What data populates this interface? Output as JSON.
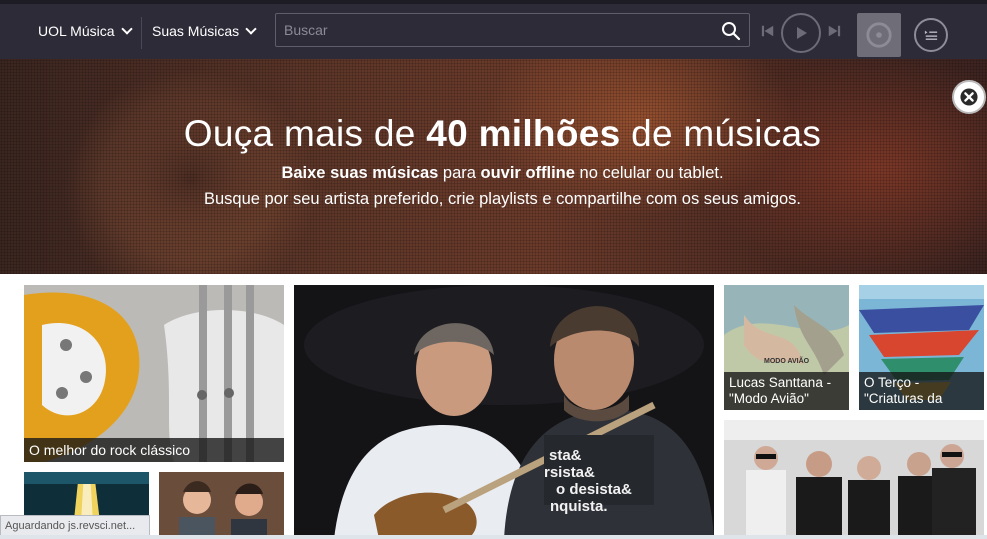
{
  "nav": {
    "menu1_label": "UOL Música",
    "menu2_label": "Suas Músicas"
  },
  "search": {
    "placeholder": "Buscar",
    "value": ""
  },
  "hero": {
    "title_pre": "Ouça mais de ",
    "title_bold": "40 milhões",
    "title_post": " de músicas",
    "line1_bold1": "Baixe suas músicas",
    "line1_mid": " para ",
    "line1_bold2": "ouvir offline",
    "line1_post": " no celular ou tablet.",
    "line2": "Busque por seu artista preferido, crie playlists e compartilhe com os seus amigos."
  },
  "cards": {
    "rock_caption": "O melhor do rock clássico",
    "lucas_caption_line1": "Lucas Santtana -",
    "lucas_caption_line2": "\"Modo Avião\"",
    "lucas_cover_text": "MODO AVIÃO",
    "terco_caption_line1": "O Terço -",
    "terco_caption_line2": "\"Criaturas da",
    "shirt_text": "sta& rsista& o desista& nquista."
  },
  "status": {
    "text": "Aguardando js.revsci.net..."
  },
  "colors": {
    "topbar": "#2d2b38",
    "caption_bg": "#141414"
  },
  "icons": [
    "chevron-down-icon",
    "search-icon",
    "skip-back-icon",
    "play-icon",
    "skip-forward-icon",
    "disc-icon",
    "queue-icon",
    "close-icon"
  ]
}
